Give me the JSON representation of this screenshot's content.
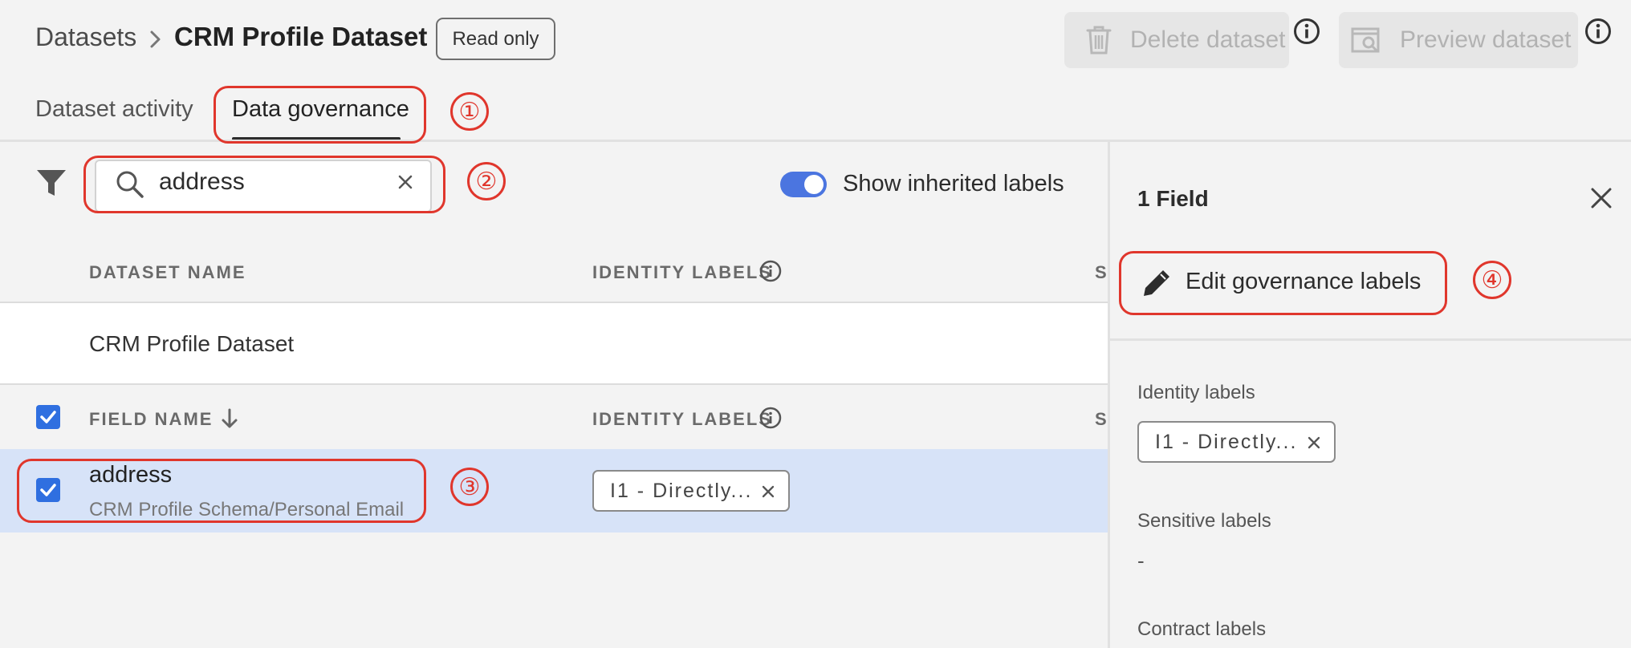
{
  "header": {
    "breadcrumb_root": "Datasets",
    "breadcrumb_current": "CRM Profile Dataset",
    "readonly_label": "Read only",
    "delete_label": "Delete dataset",
    "preview_label": "Preview dataset"
  },
  "tabs": [
    {
      "label": "Dataset activity",
      "active": false
    },
    {
      "label": "Data governance",
      "active": true
    }
  ],
  "toolbar": {
    "search_value": "address",
    "toggle_on": true,
    "toggle_label": "Show inherited labels"
  },
  "table": {
    "dataset_header": {
      "name": "DATASET NAME",
      "identity": "IDENTITY LABELS",
      "sensitive_prefix": "S"
    },
    "dataset_row": {
      "name": "CRM Profile Dataset"
    },
    "field_header": {
      "name": "FIELD NAME",
      "identity": "IDENTITY LABELS",
      "sensitive_prefix": "S"
    },
    "field_rows": [
      {
        "name": "address",
        "path": "CRM Profile Schema/Personal Email",
        "identity_tag": "I1 - Directly...",
        "selected": true
      }
    ]
  },
  "panel": {
    "title": "1 Field",
    "edit_label": "Edit governance labels",
    "identity_label": "Identity labels",
    "identity_tag": "I1 - Directly...",
    "sensitive_label": "Sensitive labels",
    "sensitive_value": "-",
    "contract_label": "Contract labels"
  },
  "annotations": [
    "①",
    "②",
    "③",
    "④"
  ],
  "colors": {
    "accent": "#2f6fe0",
    "annotation": "#e0362c",
    "selected_row": "#d7e3f8",
    "toggle": "#4b75e0"
  }
}
